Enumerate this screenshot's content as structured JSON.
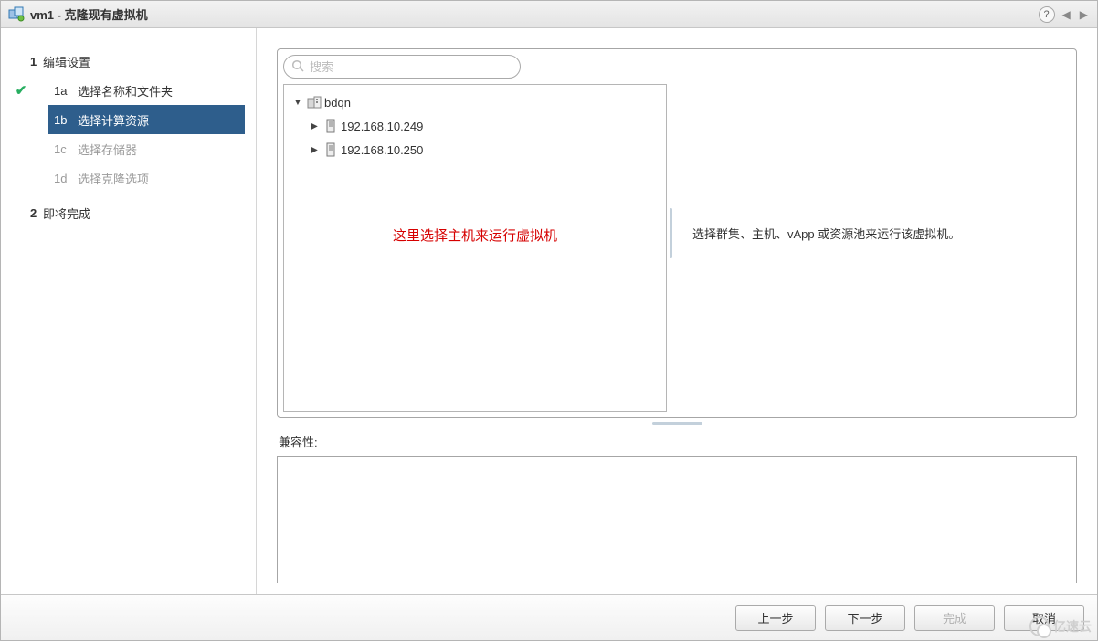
{
  "dialog": {
    "title": "vm1 - 克隆现有虚拟机"
  },
  "sidebar": {
    "step1": {
      "num": "1",
      "label": "编辑设置"
    },
    "step1a": {
      "num": "1a",
      "label": "选择名称和文件夹"
    },
    "step1b": {
      "num": "1b",
      "label": "选择计算资源"
    },
    "step1c": {
      "num": "1c",
      "label": "选择存储器"
    },
    "step1d": {
      "num": "1d",
      "label": "选择克隆选项"
    },
    "step2": {
      "num": "2",
      "label": "即将完成"
    }
  },
  "search": {
    "placeholder": "搜索"
  },
  "tree": {
    "root": "bdqn",
    "host1": "192.168.10.249",
    "host2": "192.168.10.250"
  },
  "annotation": "这里选择主机来运行虚拟机",
  "info_text": "选择群集、主机、vApp 或资源池来运行该虚拟机。",
  "compat": {
    "label": "兼容性:"
  },
  "buttons": {
    "back": "上一步",
    "next": "下一步",
    "finish": "完成",
    "cancel": "取消"
  },
  "watermark": "亿速云"
}
